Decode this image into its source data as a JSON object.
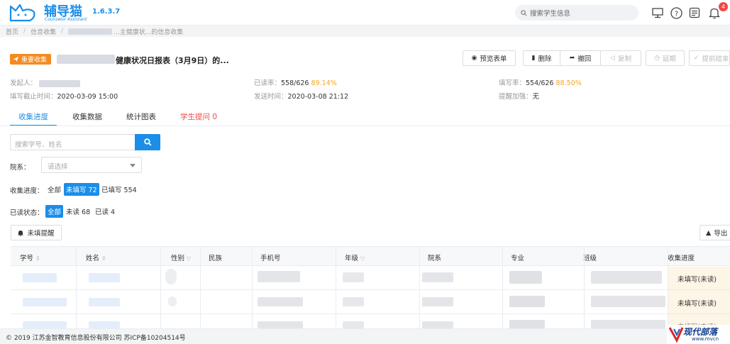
{
  "app": {
    "name": "辅导猫",
    "subtitle": "Counselor Assistant",
    "version": "1.6.3.7",
    "search_placeholder": "搜索学生信息",
    "notification_count": "4"
  },
  "breadcrumb": [
    "首页",
    "信息收集",
    "...主健康状...的信息收集"
  ],
  "task": {
    "tag": "重要收集",
    "title": "健康状况日报表（3月9日）的...",
    "buttons": {
      "preview": "预览表单",
      "delete": "删除",
      "withdraw": "撤回",
      "copy": "复制",
      "extend": "延期",
      "end_early": "提前结束"
    },
    "meta": {
      "initiator_label": "发起人：",
      "deadline_label": "填写截止时间：",
      "deadline": "2020-03-09 15:00",
      "read_rate_label": "已读率：",
      "read_rate_count": "558/626",
      "read_rate_pct": "89.14%",
      "send_time_label": "发送时间：",
      "send_time": "2020-03-08 21:12",
      "fill_rate_label": "填写率：",
      "fill_rate_count": "554/626",
      "fill_rate_pct": "88.50%",
      "reminder_label": "提醒加强：",
      "reminder": "无"
    }
  },
  "tabs": [
    "收集进度",
    "收集数据",
    "统计图表",
    "学生提问 0"
  ],
  "filters": {
    "search_placeholder": "搜索学号、姓名",
    "dept_label": "院系：",
    "dept_placeholder": "请选择",
    "progress_label": "收集进度：",
    "progress_all": "全部",
    "progress_unfilled": "未填写 72",
    "progress_filled": "已填写 554",
    "read_label": "已读状态：",
    "read_all": "全部",
    "read_unread": "未读 68",
    "read_read": "已读 4"
  },
  "actions": {
    "remind": "未填提醒",
    "export": "导出"
  },
  "table": {
    "headers": [
      "学号",
      "姓名",
      "性别",
      "民族",
      "手机号",
      "年级",
      "院系",
      "专业",
      "班级",
      "收集进度"
    ],
    "rows": [
      {
        "status": "未填写(未读)"
      },
      {
        "status": "未填写(未读)"
      },
      {
        "status": "未填写(未读)"
      }
    ]
  },
  "footer": "© 2019 江苏金智教育信息股份有限公司 苏ICP备10204514号",
  "watermark": {
    "text": "现代部落",
    "url": "www.mvcn"
  },
  "colors": {
    "accent": "#1a8ee8",
    "tag": "#f58a1f",
    "alert": "#f04848",
    "highlight": "#f5a623"
  }
}
